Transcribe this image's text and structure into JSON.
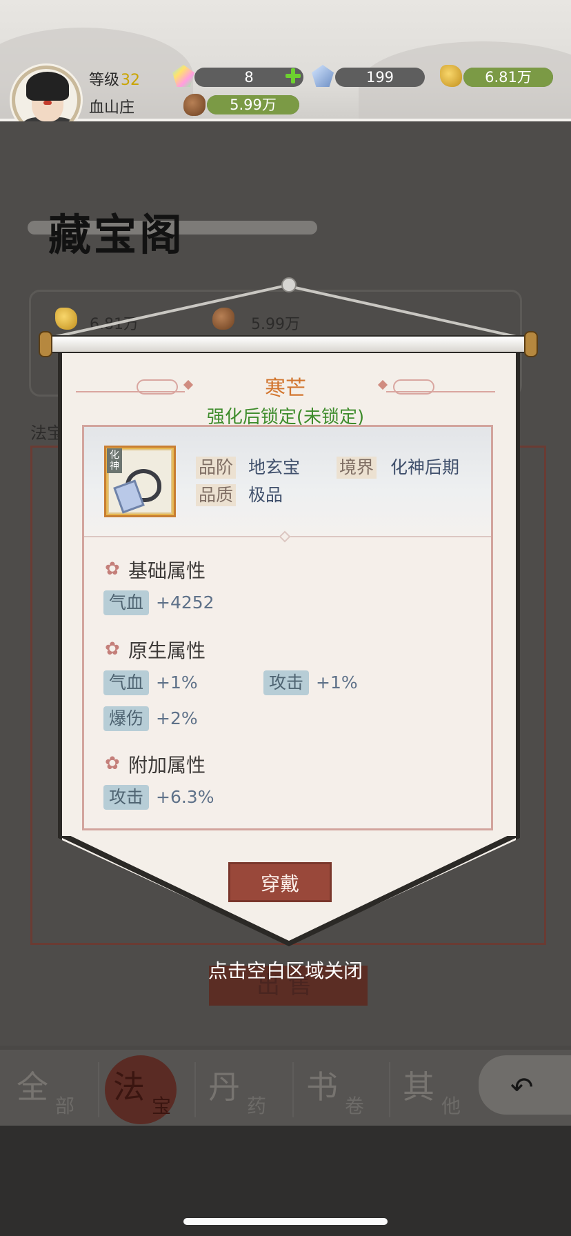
{
  "header": {
    "level_label": "等级",
    "level_value": "32",
    "sect_name": "血山庄",
    "resources": [
      {
        "icon": "rainbow-gem-icon",
        "value": "8",
        "fill_fraction": 0.0
      },
      {
        "icon": "blue-crystal-icon",
        "value": "199",
        "fill_fraction": 0.0
      },
      {
        "icon": "gold-ore-icon",
        "value": "6.81万",
        "fill_fraction": 1.0
      },
      {
        "icon": "wood-icon",
        "value": "5.99万",
        "fill_fraction": 1.0
      }
    ]
  },
  "background": {
    "title": "藏宝阁",
    "gold": "6.81万",
    "wood": "5.99万",
    "section_label": "法宝",
    "sell_button": "出售"
  },
  "tabs": [
    {
      "big": "全",
      "small": "部",
      "active": false
    },
    {
      "big": "法",
      "small": "宝",
      "active": true
    },
    {
      "big": "丹",
      "small": "药",
      "active": false
    },
    {
      "big": "书",
      "small": "卷",
      "active": false
    },
    {
      "big": "其",
      "small": "他",
      "active": false
    }
  ],
  "modal": {
    "item_name": "寒芒",
    "lock_status": "强化后锁定(未锁定)",
    "icon_tag": "化神",
    "grade_label": "品阶",
    "grade_value": "地玄宝",
    "realm_label": "境界",
    "realm_value": "化神后期",
    "quality_label": "品质",
    "quality_value": "极品",
    "sections": [
      {
        "title": "基础属性",
        "attrs": [
          {
            "name": "气血",
            "value": "+4252"
          }
        ]
      },
      {
        "title": "原生属性",
        "attrs": [
          {
            "name": "气血",
            "value": "+1%"
          },
          {
            "name": "攻击",
            "value": "+1%"
          },
          {
            "name": "爆伤",
            "value": "+2%"
          }
        ]
      },
      {
        "title": "附加属性",
        "attrs": [
          {
            "name": "攻击",
            "value": "+6.3%"
          }
        ]
      }
    ],
    "wear_button": "穿戴",
    "close_hint": "点击空白区域关闭"
  },
  "colors": {
    "item_name": "#d2762f",
    "lock_status": "#3e8c2c",
    "wear_button": "#99483a"
  }
}
